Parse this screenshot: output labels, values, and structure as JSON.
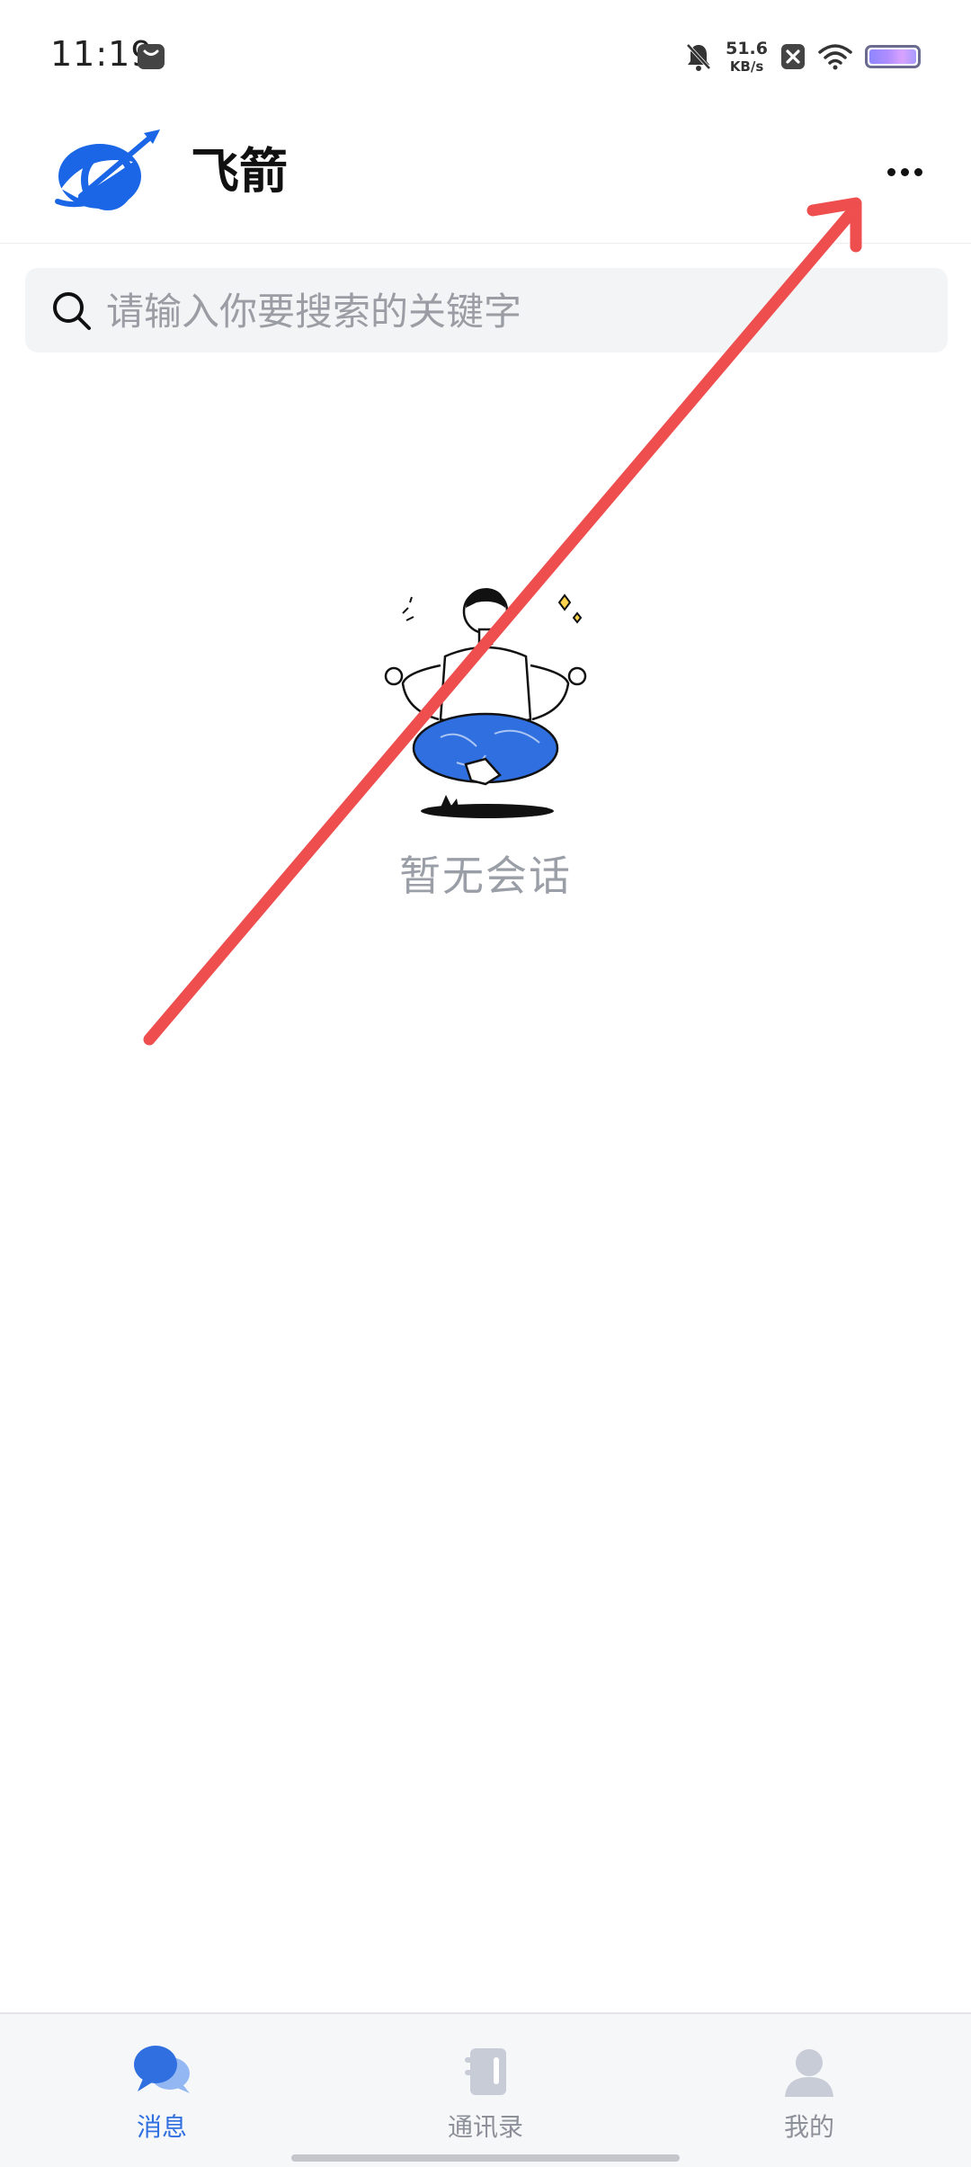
{
  "status_bar": {
    "time": "11:19",
    "speed_value": "51.6",
    "speed_unit": "KB/s",
    "icons": [
      "notification-icon",
      "mute-icon",
      "close-box-icon",
      "wifi-icon",
      "battery-icon"
    ]
  },
  "header": {
    "title": "飞箭",
    "more_icon": "more-horizontal-icon"
  },
  "search": {
    "placeholder": "请输入你要搜索的关键字",
    "value": ""
  },
  "empty_state": {
    "text": "暂无会话"
  },
  "bottom_nav": {
    "tabs": [
      {
        "label": "消息",
        "icon": "chat-bubbles-icon",
        "active": true
      },
      {
        "label": "通讯录",
        "icon": "contacts-book-icon",
        "active": false
      },
      {
        "label": "我的",
        "icon": "person-icon",
        "active": false
      }
    ]
  },
  "colors": {
    "accent": "#2f6fe0",
    "annotation_arrow": "#ee4e4e",
    "inactive": "#8c9099"
  }
}
